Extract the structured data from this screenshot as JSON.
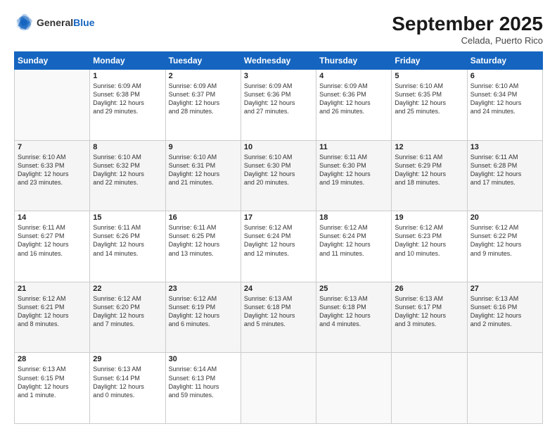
{
  "logo": {
    "line1": "General",
    "line2": "Blue"
  },
  "title": "September 2025",
  "location": "Celada, Puerto Rico",
  "days_of_week": [
    "Sunday",
    "Monday",
    "Tuesday",
    "Wednesday",
    "Thursday",
    "Friday",
    "Saturday"
  ],
  "weeks": [
    [
      {
        "day": "",
        "info": ""
      },
      {
        "day": "1",
        "info": "Sunrise: 6:09 AM\nSunset: 6:38 PM\nDaylight: 12 hours\nand 29 minutes."
      },
      {
        "day": "2",
        "info": "Sunrise: 6:09 AM\nSunset: 6:37 PM\nDaylight: 12 hours\nand 28 minutes."
      },
      {
        "day": "3",
        "info": "Sunrise: 6:09 AM\nSunset: 6:36 PM\nDaylight: 12 hours\nand 27 minutes."
      },
      {
        "day": "4",
        "info": "Sunrise: 6:09 AM\nSunset: 6:36 PM\nDaylight: 12 hours\nand 26 minutes."
      },
      {
        "day": "5",
        "info": "Sunrise: 6:10 AM\nSunset: 6:35 PM\nDaylight: 12 hours\nand 25 minutes."
      },
      {
        "day": "6",
        "info": "Sunrise: 6:10 AM\nSunset: 6:34 PM\nDaylight: 12 hours\nand 24 minutes."
      }
    ],
    [
      {
        "day": "7",
        "info": "Sunrise: 6:10 AM\nSunset: 6:33 PM\nDaylight: 12 hours\nand 23 minutes."
      },
      {
        "day": "8",
        "info": "Sunrise: 6:10 AM\nSunset: 6:32 PM\nDaylight: 12 hours\nand 22 minutes."
      },
      {
        "day": "9",
        "info": "Sunrise: 6:10 AM\nSunset: 6:31 PM\nDaylight: 12 hours\nand 21 minutes."
      },
      {
        "day": "10",
        "info": "Sunrise: 6:10 AM\nSunset: 6:30 PM\nDaylight: 12 hours\nand 20 minutes."
      },
      {
        "day": "11",
        "info": "Sunrise: 6:11 AM\nSunset: 6:30 PM\nDaylight: 12 hours\nand 19 minutes."
      },
      {
        "day": "12",
        "info": "Sunrise: 6:11 AM\nSunset: 6:29 PM\nDaylight: 12 hours\nand 18 minutes."
      },
      {
        "day": "13",
        "info": "Sunrise: 6:11 AM\nSunset: 6:28 PM\nDaylight: 12 hours\nand 17 minutes."
      }
    ],
    [
      {
        "day": "14",
        "info": "Sunrise: 6:11 AM\nSunset: 6:27 PM\nDaylight: 12 hours\nand 16 minutes."
      },
      {
        "day": "15",
        "info": "Sunrise: 6:11 AM\nSunset: 6:26 PM\nDaylight: 12 hours\nand 14 minutes."
      },
      {
        "day": "16",
        "info": "Sunrise: 6:11 AM\nSunset: 6:25 PM\nDaylight: 12 hours\nand 13 minutes."
      },
      {
        "day": "17",
        "info": "Sunrise: 6:12 AM\nSunset: 6:24 PM\nDaylight: 12 hours\nand 12 minutes."
      },
      {
        "day": "18",
        "info": "Sunrise: 6:12 AM\nSunset: 6:24 PM\nDaylight: 12 hours\nand 11 minutes."
      },
      {
        "day": "19",
        "info": "Sunrise: 6:12 AM\nSunset: 6:23 PM\nDaylight: 12 hours\nand 10 minutes."
      },
      {
        "day": "20",
        "info": "Sunrise: 6:12 AM\nSunset: 6:22 PM\nDaylight: 12 hours\nand 9 minutes."
      }
    ],
    [
      {
        "day": "21",
        "info": "Sunrise: 6:12 AM\nSunset: 6:21 PM\nDaylight: 12 hours\nand 8 minutes."
      },
      {
        "day": "22",
        "info": "Sunrise: 6:12 AM\nSunset: 6:20 PM\nDaylight: 12 hours\nand 7 minutes."
      },
      {
        "day": "23",
        "info": "Sunrise: 6:12 AM\nSunset: 6:19 PM\nDaylight: 12 hours\nand 6 minutes."
      },
      {
        "day": "24",
        "info": "Sunrise: 6:13 AM\nSunset: 6:18 PM\nDaylight: 12 hours\nand 5 minutes."
      },
      {
        "day": "25",
        "info": "Sunrise: 6:13 AM\nSunset: 6:18 PM\nDaylight: 12 hours\nand 4 minutes."
      },
      {
        "day": "26",
        "info": "Sunrise: 6:13 AM\nSunset: 6:17 PM\nDaylight: 12 hours\nand 3 minutes."
      },
      {
        "day": "27",
        "info": "Sunrise: 6:13 AM\nSunset: 6:16 PM\nDaylight: 12 hours\nand 2 minutes."
      }
    ],
    [
      {
        "day": "28",
        "info": "Sunrise: 6:13 AM\nSunset: 6:15 PM\nDaylight: 12 hours\nand 1 minute."
      },
      {
        "day": "29",
        "info": "Sunrise: 6:13 AM\nSunset: 6:14 PM\nDaylight: 12 hours\nand 0 minutes."
      },
      {
        "day": "30",
        "info": "Sunrise: 6:14 AM\nSunset: 6:13 PM\nDaylight: 11 hours\nand 59 minutes."
      },
      {
        "day": "",
        "info": ""
      },
      {
        "day": "",
        "info": ""
      },
      {
        "day": "",
        "info": ""
      },
      {
        "day": "",
        "info": ""
      }
    ]
  ]
}
